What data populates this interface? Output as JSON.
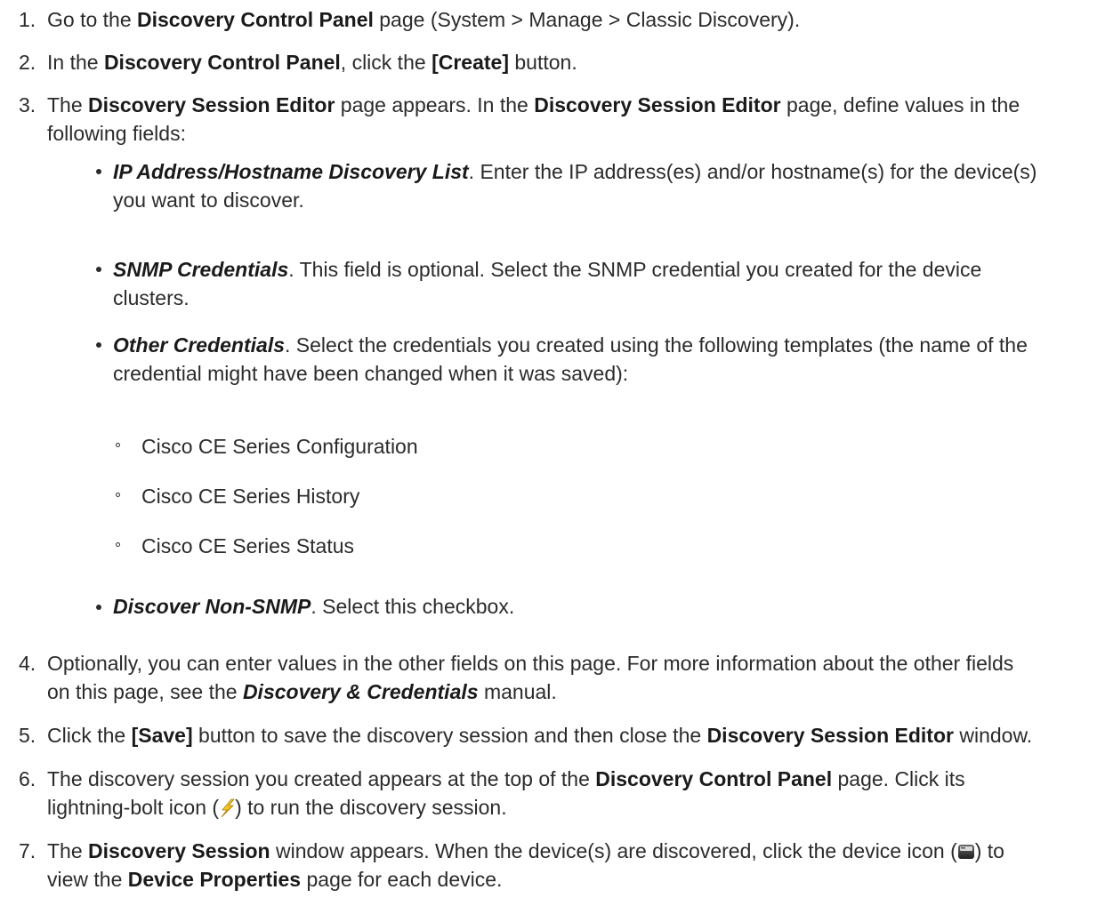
{
  "steps": [
    {
      "num": "1.",
      "l1": [
        "Go to the ",
        "Discovery Control Panel",
        " page (System > Manage > Classic Discovery)."
      ]
    },
    {
      "num": "2.",
      "l1": [
        "In the ",
        "Discovery Control Panel",
        ", click the ",
        "[Create]",
        " button."
      ]
    },
    {
      "num": "3.",
      "l1": [
        "The ",
        "Discovery Session Editor",
        " page appears. In the ",
        "Discovery Session Editor",
        " page, define values in the"
      ],
      "l2": "following fields:"
    },
    {
      "num": "4.",
      "l1": "Optionally, you can enter values in the other fields on this page. For more information about the other fields",
      "l2": [
        "on this page, see the ",
        "Discovery & Credentials",
        " manual."
      ]
    },
    {
      "num": "5.",
      "l1": [
        "Click the ",
        "[Save]",
        " button to save the discovery session and then close the ",
        "Discovery Session Editor",
        " window."
      ]
    },
    {
      "num": "6.",
      "l1": [
        "The discovery session you created appears at the top of the ",
        "Discovery Control Panel",
        " page. Click its"
      ],
      "l2": [
        "lightning-bolt icon (",
        ") to run the discovery session."
      ]
    },
    {
      "num": "7.",
      "l1": [
        "The ",
        "Discovery Session",
        " window appears. When the device(s) are discovered, click the device icon (",
        ") to"
      ],
      "l2": [
        "view the ",
        "Device Properties",
        " page for each device."
      ]
    }
  ],
  "fields": [
    {
      "name": "IP Address/Hostname Discovery List",
      "l1": ". Enter the IP address(es) and/or hostname(s) for the device(s)",
      "l2": "you want to discover."
    },
    {
      "name": "SNMP Credentials",
      "l1": ". This field is optional. Select the SNMP credential you created for the device",
      "l2": "clusters."
    },
    {
      "name": "Other Credentials",
      "l1": ". Select the credentials you created using the following templates (the name of the",
      "l2": "credential might have been changed when it was saved):"
    },
    {
      "name": "Discover Non-SNMP",
      "l1": ". Select this checkbox."
    }
  ],
  "templates": [
    "Cisco CE Series Configuration",
    "Cisco CE Series History",
    "Cisco CE Series Status"
  ],
  "icons": {
    "bolt": "lightning-bolt-icon",
    "device": "device-icon"
  }
}
